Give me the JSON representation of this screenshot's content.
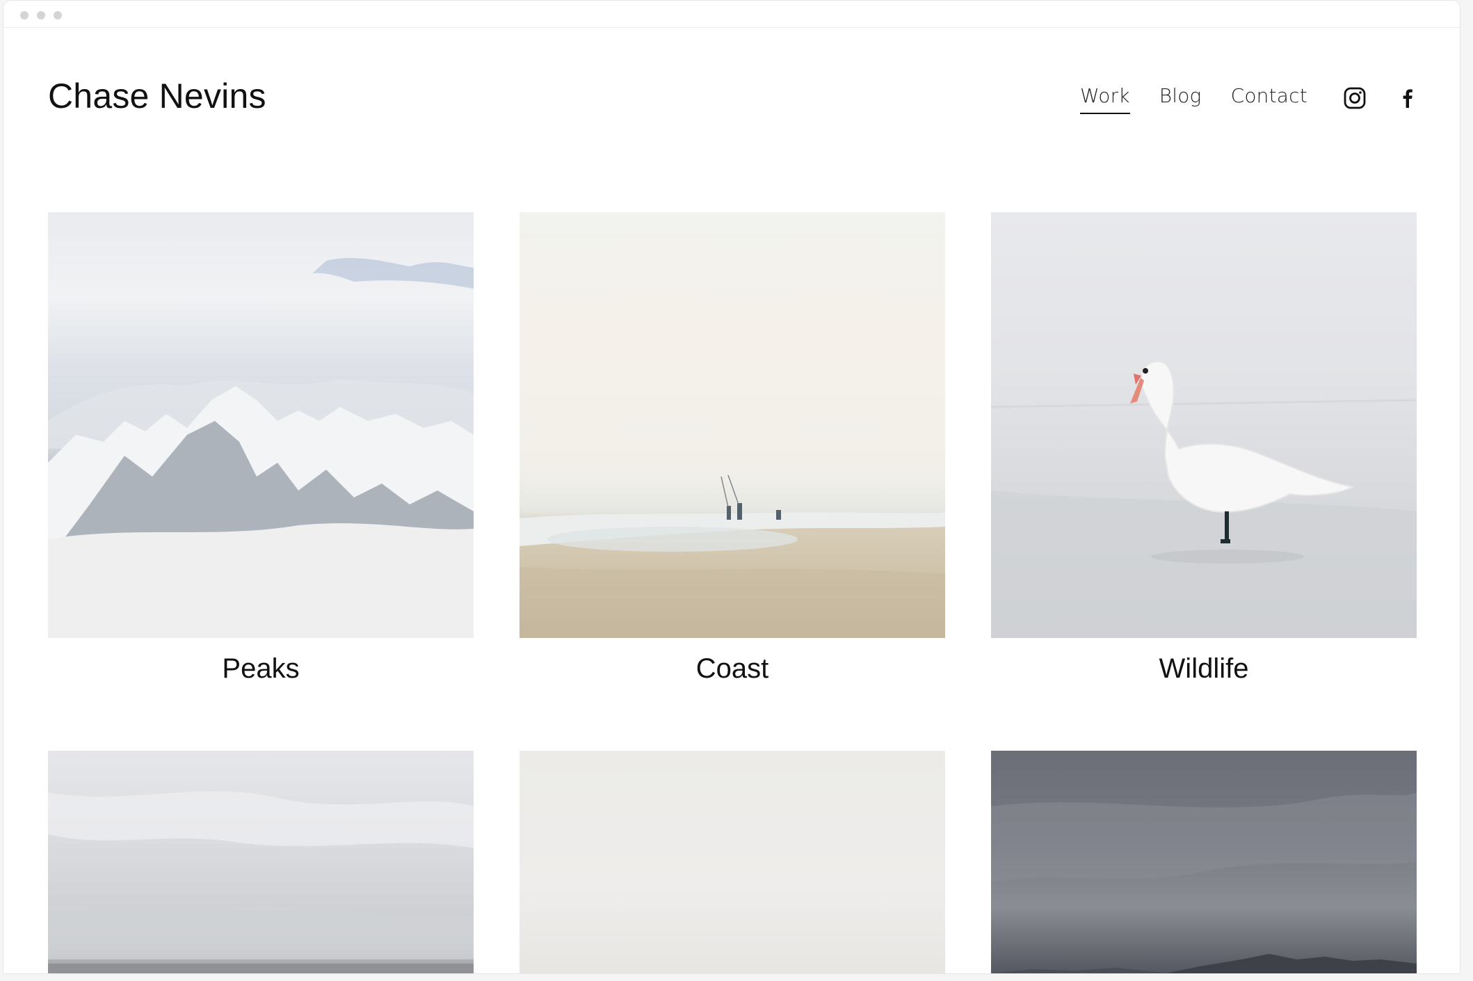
{
  "site": {
    "title": "Chase Nevins"
  },
  "nav": {
    "items": [
      {
        "label": "Work",
        "active": true
      },
      {
        "label": "Blog",
        "active": false
      },
      {
        "label": "Contact",
        "active": false
      }
    ]
  },
  "social": {
    "icons": [
      "instagram-icon",
      "facebook-icon"
    ]
  },
  "gallery": {
    "row1": [
      {
        "caption": "Peaks"
      },
      {
        "caption": "Coast"
      },
      {
        "caption": "Wildlife"
      }
    ]
  },
  "colors": {
    "text": "#111111",
    "background": "#ffffff",
    "nav_underline": "#111111"
  }
}
